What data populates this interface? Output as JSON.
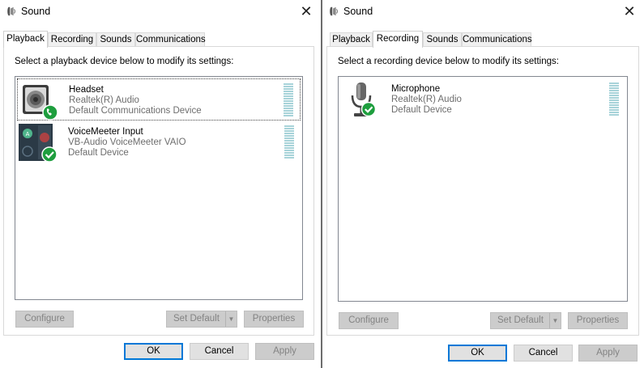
{
  "left": {
    "title": "Sound",
    "tabs": [
      {
        "label": "Playback",
        "active": true
      },
      {
        "label": "Recording",
        "active": false
      },
      {
        "label": "Sounds",
        "active": false
      },
      {
        "label": "Communications",
        "active": false
      }
    ],
    "instructions": "Select a playback device below to modify its settings:",
    "devices": [
      {
        "name": "Headset",
        "driver": "Realtek(R) Audio",
        "status": "Default Communications Device",
        "icon": "headset-speaker-icon",
        "badge": "phone-check-badge",
        "selected": true
      },
      {
        "name": "VoiceMeeter Input",
        "driver": "VB-Audio VoiceMeeter VAIO",
        "status": "Default Device",
        "icon": "voicemeeter-icon",
        "badge": "green-check-badge",
        "selected": false
      }
    ],
    "buttons": {
      "configure": "Configure",
      "set_default": "Set Default",
      "properties": "Properties"
    },
    "footer": {
      "ok": "OK",
      "cancel": "Cancel",
      "apply": "Apply"
    }
  },
  "right": {
    "title": "Sound",
    "tabs": [
      {
        "label": "Playback",
        "active": false
      },
      {
        "label": "Recording",
        "active": true
      },
      {
        "label": "Sounds",
        "active": false
      },
      {
        "label": "Communications",
        "active": false
      }
    ],
    "instructions": "Select a recording device below to modify its settings:",
    "devices": [
      {
        "name": "Microphone",
        "driver": "Realtek(R) Audio",
        "status": "Default Device",
        "icon": "microphone-icon",
        "badge": "green-check-badge",
        "selected": false
      }
    ],
    "buttons": {
      "configure": "Configure",
      "set_default": "Set Default",
      "properties": "Properties"
    },
    "footer": {
      "ok": "OK",
      "cancel": "Cancel",
      "apply": "Apply"
    }
  },
  "colors": {
    "accent": "#0078d7",
    "meter": "#a7d3d9",
    "check_green": "#1e9e3e",
    "disabled_text": "#838383"
  }
}
